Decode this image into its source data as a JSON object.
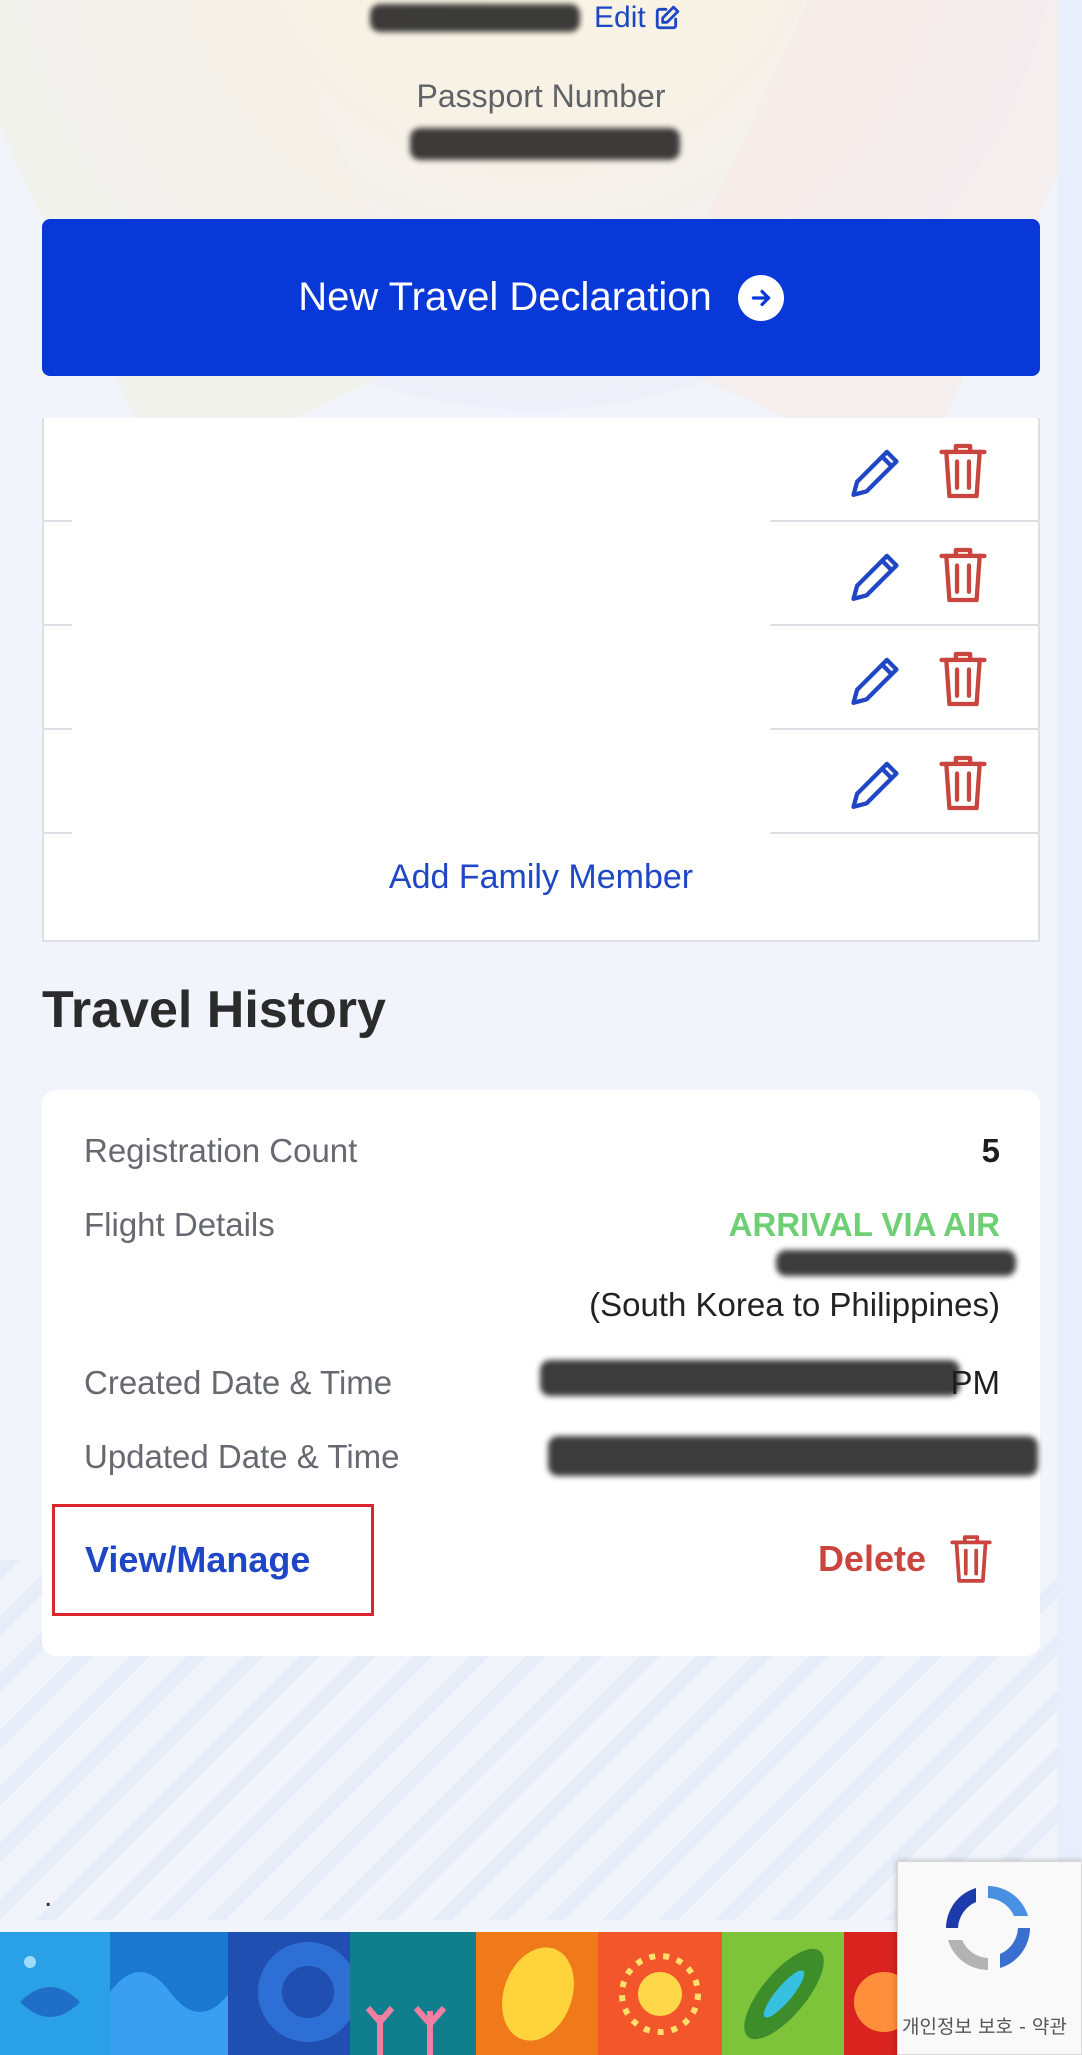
{
  "profile": {
    "edit_label": "Edit",
    "passport_label": "Passport Number"
  },
  "actions": {
    "new_declaration_label": "New Travel Declaration"
  },
  "family": {
    "rows": 4,
    "add_member_label": "Add Family Member"
  },
  "travel_history": {
    "title": "Travel History",
    "registration_count_label": "Registration Count",
    "registration_count": "5",
    "flight_details_label": "Flight Details",
    "arrival_mode": "ARRIVAL VIA AIR",
    "route": "(South Korea to Philippines)",
    "created_label": "Created Date & Time",
    "created_suffix": "PM",
    "updated_label": "Updated Date & Time",
    "view_manage_label": "View/Manage",
    "delete_label": "Delete"
  },
  "footer": {
    "dot": "."
  },
  "captcha": {
    "text": "개인정보 보호 - 약관"
  },
  "colors": {
    "primary": "#0838d8",
    "link": "#1f47c5",
    "danger": "#c9453e",
    "success": "#6fcf74",
    "highlight_box": "#d9262f"
  }
}
